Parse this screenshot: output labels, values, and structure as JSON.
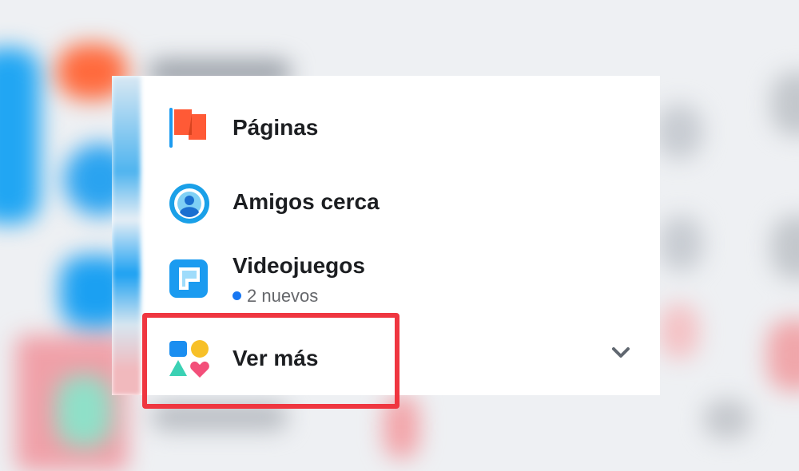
{
  "menu": {
    "items": [
      {
        "id": "paginas",
        "label": "Páginas",
        "icon": "flag-icon"
      },
      {
        "id": "amigos-cerca",
        "label": "Amigos cerca",
        "icon": "nearby-friends-icon"
      },
      {
        "id": "videojuegos",
        "label": "Videojuegos",
        "sublabel": "2 nuevos",
        "icon": "gaming-icon"
      },
      {
        "id": "ver-mas",
        "label": "Ver más",
        "icon": "shapes-icon",
        "trailing_icon": "chevron-down-icon"
      }
    ]
  },
  "colors": {
    "accent": "#1877f2",
    "highlight": "#ef3640",
    "flag": "#ff5a36",
    "nearby": "#1aa0e8",
    "gaming": "#1b9bf0"
  }
}
